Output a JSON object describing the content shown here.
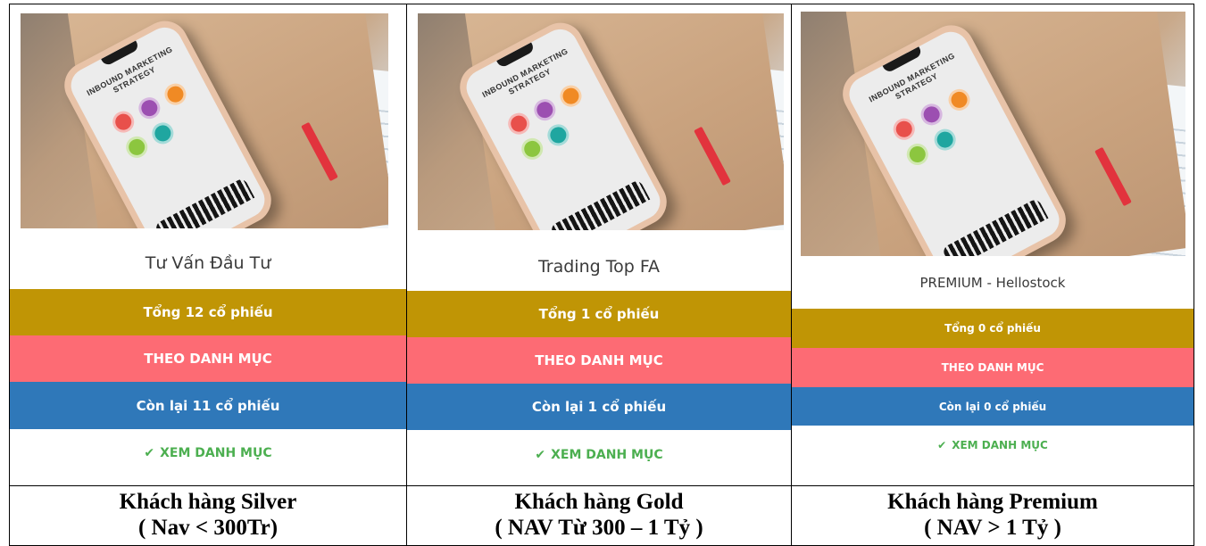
{
  "cards": [
    {
      "phone_headline": "INBOUND MARKETING STRATEGY",
      "title": "Tư Vấn Đầu Tư",
      "total": "Tổng 12 cổ phiếu",
      "category": "THEO DANH MỤC",
      "remaining": "Còn lại 11 cổ phiếu",
      "link": "XEM DANH MỤC",
      "caption_line1": "Khách hàng Silver",
      "caption_line2": "( Nav < 300Tr)"
    },
    {
      "phone_headline": "INBOUND MARKETING STRATEGY",
      "title": "Trading Top FA",
      "total": "Tổng 1 cổ phiếu",
      "category": "THEO DANH MỤC",
      "remaining": "Còn lại 1 cổ phiếu",
      "link": "XEM DANH MỤC",
      "caption_line1": "Khách hàng Gold",
      "caption_line2": "( NAV Từ 300 – 1 Tỷ )"
    },
    {
      "phone_headline": "INBOUND MARKETING STRATEGY",
      "title": "PREMIUM - Hellostock",
      "total": "Tổng 0 cổ phiếu",
      "category": "THEO DANH MỤC",
      "remaining": "Còn lại 0 cổ phiếu",
      "link": "XEM DANH MỤC",
      "caption_line1": "Khách hàng Premium",
      "caption_line2": "( NAV > 1 Tỷ )"
    }
  ],
  "icons": {
    "link_icon": "check-icon",
    "check_glyph": "✔"
  },
  "colors": {
    "gold": "#c09505",
    "pink": "#fd6b74",
    "blue": "#2f78b9",
    "green": "#4caf50"
  }
}
